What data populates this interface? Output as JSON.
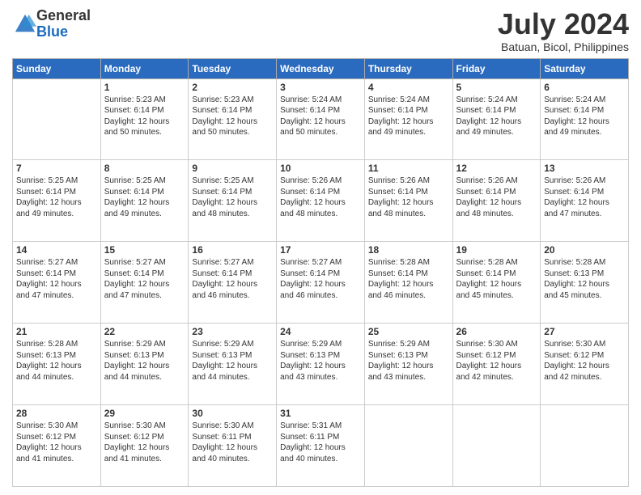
{
  "header": {
    "logo_general": "General",
    "logo_blue": "Blue",
    "month_year": "July 2024",
    "location": "Batuan, Bicol, Philippines"
  },
  "days_of_week": [
    "Sunday",
    "Monday",
    "Tuesday",
    "Wednesday",
    "Thursday",
    "Friday",
    "Saturday"
  ],
  "weeks": [
    [
      {
        "day": "",
        "info": ""
      },
      {
        "day": "1",
        "info": "Sunrise: 5:23 AM\nSunset: 6:14 PM\nDaylight: 12 hours\nand 50 minutes."
      },
      {
        "day": "2",
        "info": "Sunrise: 5:23 AM\nSunset: 6:14 PM\nDaylight: 12 hours\nand 50 minutes."
      },
      {
        "day": "3",
        "info": "Sunrise: 5:24 AM\nSunset: 6:14 PM\nDaylight: 12 hours\nand 50 minutes."
      },
      {
        "day": "4",
        "info": "Sunrise: 5:24 AM\nSunset: 6:14 PM\nDaylight: 12 hours\nand 49 minutes."
      },
      {
        "day": "5",
        "info": "Sunrise: 5:24 AM\nSunset: 6:14 PM\nDaylight: 12 hours\nand 49 minutes."
      },
      {
        "day": "6",
        "info": "Sunrise: 5:24 AM\nSunset: 6:14 PM\nDaylight: 12 hours\nand 49 minutes."
      }
    ],
    [
      {
        "day": "7",
        "info": "Sunrise: 5:25 AM\nSunset: 6:14 PM\nDaylight: 12 hours\nand 49 minutes."
      },
      {
        "day": "8",
        "info": "Sunrise: 5:25 AM\nSunset: 6:14 PM\nDaylight: 12 hours\nand 49 minutes."
      },
      {
        "day": "9",
        "info": "Sunrise: 5:25 AM\nSunset: 6:14 PM\nDaylight: 12 hours\nand 48 minutes."
      },
      {
        "day": "10",
        "info": "Sunrise: 5:26 AM\nSunset: 6:14 PM\nDaylight: 12 hours\nand 48 minutes."
      },
      {
        "day": "11",
        "info": "Sunrise: 5:26 AM\nSunset: 6:14 PM\nDaylight: 12 hours\nand 48 minutes."
      },
      {
        "day": "12",
        "info": "Sunrise: 5:26 AM\nSunset: 6:14 PM\nDaylight: 12 hours\nand 48 minutes."
      },
      {
        "day": "13",
        "info": "Sunrise: 5:26 AM\nSunset: 6:14 PM\nDaylight: 12 hours\nand 47 minutes."
      }
    ],
    [
      {
        "day": "14",
        "info": "Sunrise: 5:27 AM\nSunset: 6:14 PM\nDaylight: 12 hours\nand 47 minutes."
      },
      {
        "day": "15",
        "info": "Sunrise: 5:27 AM\nSunset: 6:14 PM\nDaylight: 12 hours\nand 47 minutes."
      },
      {
        "day": "16",
        "info": "Sunrise: 5:27 AM\nSunset: 6:14 PM\nDaylight: 12 hours\nand 46 minutes."
      },
      {
        "day": "17",
        "info": "Sunrise: 5:27 AM\nSunset: 6:14 PM\nDaylight: 12 hours\nand 46 minutes."
      },
      {
        "day": "18",
        "info": "Sunrise: 5:28 AM\nSunset: 6:14 PM\nDaylight: 12 hours\nand 46 minutes."
      },
      {
        "day": "19",
        "info": "Sunrise: 5:28 AM\nSunset: 6:14 PM\nDaylight: 12 hours\nand 45 minutes."
      },
      {
        "day": "20",
        "info": "Sunrise: 5:28 AM\nSunset: 6:13 PM\nDaylight: 12 hours\nand 45 minutes."
      }
    ],
    [
      {
        "day": "21",
        "info": "Sunrise: 5:28 AM\nSunset: 6:13 PM\nDaylight: 12 hours\nand 44 minutes."
      },
      {
        "day": "22",
        "info": "Sunrise: 5:29 AM\nSunset: 6:13 PM\nDaylight: 12 hours\nand 44 minutes."
      },
      {
        "day": "23",
        "info": "Sunrise: 5:29 AM\nSunset: 6:13 PM\nDaylight: 12 hours\nand 44 minutes."
      },
      {
        "day": "24",
        "info": "Sunrise: 5:29 AM\nSunset: 6:13 PM\nDaylight: 12 hours\nand 43 minutes."
      },
      {
        "day": "25",
        "info": "Sunrise: 5:29 AM\nSunset: 6:13 PM\nDaylight: 12 hours\nand 43 minutes."
      },
      {
        "day": "26",
        "info": "Sunrise: 5:30 AM\nSunset: 6:12 PM\nDaylight: 12 hours\nand 42 minutes."
      },
      {
        "day": "27",
        "info": "Sunrise: 5:30 AM\nSunset: 6:12 PM\nDaylight: 12 hours\nand 42 minutes."
      }
    ],
    [
      {
        "day": "28",
        "info": "Sunrise: 5:30 AM\nSunset: 6:12 PM\nDaylight: 12 hours\nand 41 minutes."
      },
      {
        "day": "29",
        "info": "Sunrise: 5:30 AM\nSunset: 6:12 PM\nDaylight: 12 hours\nand 41 minutes."
      },
      {
        "day": "30",
        "info": "Sunrise: 5:30 AM\nSunset: 6:11 PM\nDaylight: 12 hours\nand 40 minutes."
      },
      {
        "day": "31",
        "info": "Sunrise: 5:31 AM\nSunset: 6:11 PM\nDaylight: 12 hours\nand 40 minutes."
      },
      {
        "day": "",
        "info": ""
      },
      {
        "day": "",
        "info": ""
      },
      {
        "day": "",
        "info": ""
      }
    ]
  ]
}
